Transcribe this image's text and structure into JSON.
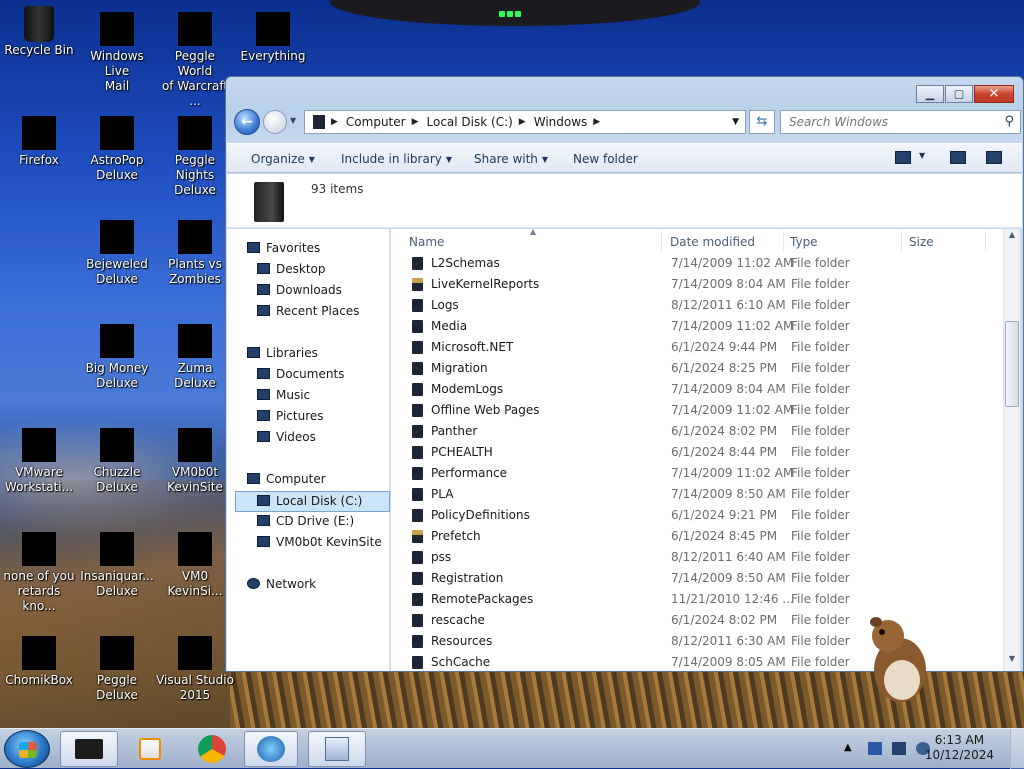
{
  "desktop": {
    "icons": [
      {
        "label": "Recycle Bin"
      },
      {
        "label": "Windows Live\nMail"
      },
      {
        "label": "Peggle World\nof Warcraft ..."
      },
      {
        "label": "Everything"
      },
      {
        "label": "Firefox"
      },
      {
        "label": "AstroPop\nDeluxe"
      },
      {
        "label": "Peggle Nights\nDeluxe"
      },
      {
        "label": "Bejeweled\nDeluxe"
      },
      {
        "label": "Plants vs\nZombies"
      },
      {
        "label": "Big Money\nDeluxe"
      },
      {
        "label": "Zuma Deluxe"
      },
      {
        "label": "VMware\nWorkstati..."
      },
      {
        "label": "Chuzzle\nDeluxe"
      },
      {
        "label": "VM0b0t\nKevinSite"
      },
      {
        "label": "none of you\nretards kno..."
      },
      {
        "label": "Insaniquar...\nDeluxe"
      },
      {
        "label": "VM0\nKevinSi..."
      },
      {
        "label": "ChomikBox"
      },
      {
        "label": "Peggle Deluxe"
      },
      {
        "label": "Visual Studio\n2015"
      }
    ]
  },
  "explorer": {
    "breadcrumb": [
      "Computer",
      "Local Disk (C:)",
      "Windows"
    ],
    "search_placeholder": "Search Windows",
    "commands": {
      "organize": "Organize",
      "include_in_library": "Include in library",
      "share_with": "Share with",
      "new_folder": "New folder"
    },
    "item_count": "93 items",
    "nav": {
      "favorites": "Favorites",
      "desktop": "Desktop",
      "downloads": "Downloads",
      "recent_places": "Recent Places",
      "libraries": "Libraries",
      "documents": "Documents",
      "music": "Music",
      "pictures": "Pictures",
      "videos": "Videos",
      "computer": "Computer",
      "local_disk": "Local Disk (C:)",
      "cd_drive": "CD Drive (E:)",
      "vm_site": "VM0b0t KevinSite",
      "network": "Network"
    },
    "columns": {
      "name": "Name",
      "date_modified": "Date modified",
      "type": "Type",
      "size": "Size"
    },
    "rows": [
      {
        "name": "L2Schemas",
        "date": "7/14/2009 11:02 AM",
        "type": "File folder"
      },
      {
        "name": "LiveKernelReports",
        "date": "7/14/2009 8:04 AM",
        "type": "File folder"
      },
      {
        "name": "Logs",
        "date": "8/12/2011 6:10 AM",
        "type": "File folder"
      },
      {
        "name": "Media",
        "date": "7/14/2009 11:02 AM",
        "type": "File folder"
      },
      {
        "name": "Microsoft.NET",
        "date": "6/1/2024 9:44 PM",
        "type": "File folder"
      },
      {
        "name": "Migration",
        "date": "6/1/2024 8:25 PM",
        "type": "File folder"
      },
      {
        "name": "ModemLogs",
        "date": "7/14/2009 8:04 AM",
        "type": "File folder"
      },
      {
        "name": "Offline Web Pages",
        "date": "7/14/2009 11:02 AM",
        "type": "File folder"
      },
      {
        "name": "Panther",
        "date": "6/1/2024 8:02 PM",
        "type": "File folder"
      },
      {
        "name": "PCHEALTH",
        "date": "6/1/2024 8:44 PM",
        "type": "File folder"
      },
      {
        "name": "Performance",
        "date": "7/14/2009 11:02 AM",
        "type": "File folder"
      },
      {
        "name": "PLA",
        "date": "7/14/2009 8:50 AM",
        "type": "File folder"
      },
      {
        "name": "PolicyDefinitions",
        "date": "6/1/2024 9:21 PM",
        "type": "File folder"
      },
      {
        "name": "Prefetch",
        "date": "6/1/2024 8:45 PM",
        "type": "File folder"
      },
      {
        "name": "pss",
        "date": "8/12/2011 6:40 AM",
        "type": "File folder"
      },
      {
        "name": "Registration",
        "date": "7/14/2009 8:50 AM",
        "type": "File folder"
      },
      {
        "name": "RemotePackages",
        "date": "11/21/2010 12:46 ...",
        "type": "File folder"
      },
      {
        "name": "rescache",
        "date": "6/1/2024 8:02 PM",
        "type": "File folder"
      },
      {
        "name": "Resources",
        "date": "8/12/2011 6:30 AM",
        "type": "File folder"
      },
      {
        "name": "SchCache",
        "date": "7/14/2009 8:05 AM",
        "type": "File folder"
      }
    ]
  },
  "taskbar": {
    "clock_time": "6:13 AM",
    "clock_date": "10/12/2024"
  },
  "colors": {
    "selection": "#cce4f7",
    "close_button": "#c9432c",
    "text_secondary": "#6d6d6d"
  }
}
